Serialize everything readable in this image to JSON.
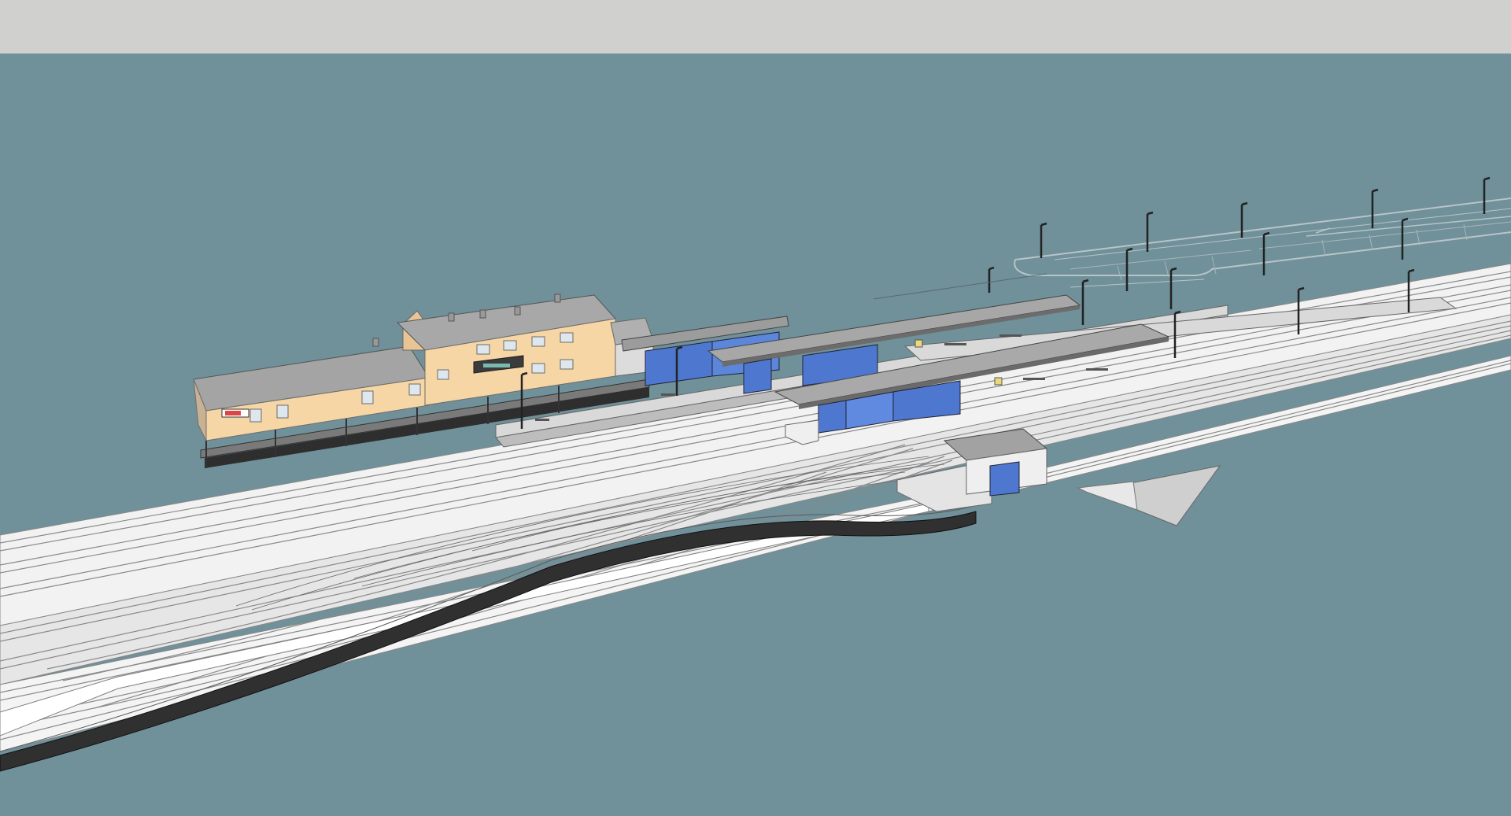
{
  "viewport": {
    "sky_color": "#d0d0ce",
    "ground_color": "#70909a"
  },
  "scene": {
    "kind": "3d-model-view",
    "subject": "railway-station",
    "objects": [
      "station-building",
      "platform-canopies",
      "glass-shelters",
      "tracks",
      "lamp-posts",
      "parking-lot",
      "underpass-entrance",
      "retaining-wall"
    ]
  },
  "colors": {
    "building_facade": "#f7d6a6",
    "roof": "#a6a6a6",
    "glass": "#4e78cf",
    "track_surface": "#f4f4f4",
    "track_lines": "#9a9a9a",
    "wall": "#333333",
    "platform": "#dcdcdc"
  },
  "icons": {
    "lamp_post": "lamp-post-icon",
    "bench": "bench-icon",
    "sign": "sign-icon"
  }
}
